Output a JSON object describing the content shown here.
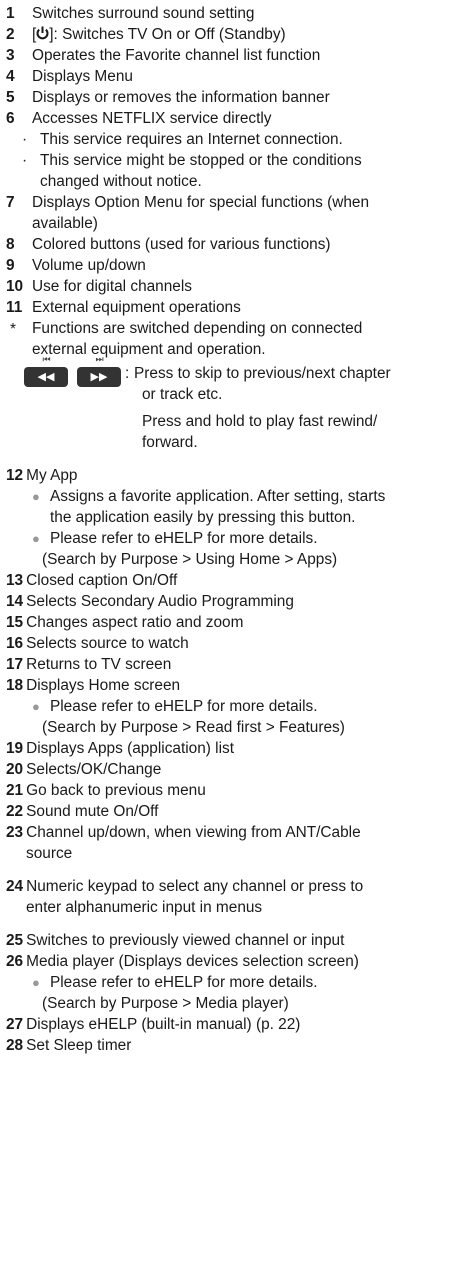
{
  "items": [
    {
      "n": "1",
      "text": "Switches surround sound setting"
    },
    {
      "n": "2",
      "bracket_open": "[",
      "icon": "power-icon",
      "text": "]: Switches TV On or Off (Standby)"
    },
    {
      "n": "3",
      "text": "Operates the Favorite channel list function"
    },
    {
      "n": "4",
      "text": "Displays Menu"
    },
    {
      "n": "5",
      "text": "Displays or removes the information banner"
    },
    {
      "n": "6",
      "text": "Accesses NETFLIX service directly",
      "notes": [
        "This service requires an Internet connection.",
        "This service might be stopped or the conditions",
        "changed without notice."
      ]
    },
    {
      "n": "7",
      "lines": [
        "Displays Option Menu for special functions (when",
        "available)"
      ]
    },
    {
      "n": "8",
      "text": "Colored buttons (used for various functions)"
    },
    {
      "n": "9",
      "text": "Volume up/down"
    },
    {
      "n": "10",
      "text": "Use for digital channels"
    },
    {
      "n": "11",
      "text": "External equipment operations",
      "asterisk": [
        "Functions are switched depending on connected",
        "external equipment and operation."
      ],
      "skip": {
        "prev_small": "⏮",
        "next_small": "⏭",
        "prev": "◀◀",
        "next": "▶▶",
        "colon": ":",
        "lines": [
          "Press to skip to previous/next chapter",
          "or track etc.",
          "Press and hold to play fast rewind/",
          "forward."
        ]
      }
    },
    {
      "n": "12",
      "text": "My App",
      "notes": [
        "Assigns a favorite application. After setting, starts",
        "the application easily by pressing this button.",
        "Please refer to eHELP for more details.",
        "(Search by Purpose > Using Home > Apps)"
      ]
    },
    {
      "n": "13",
      "text": "Closed caption On/Off"
    },
    {
      "n": "14",
      "text": "Selects Secondary Audio Programming"
    },
    {
      "n": "15",
      "text": "Changes aspect ratio and zoom"
    },
    {
      "n": "16",
      "text": "Selects source to watch"
    },
    {
      "n": "17",
      "text": "Returns to TV screen"
    },
    {
      "n": "18",
      "text": "Displays Home screen",
      "notes": [
        "Please refer to eHELP for more details.",
        "(Search by Purpose > Read first > Features)"
      ]
    },
    {
      "n": "19",
      "text": "Displays Apps (application) list"
    },
    {
      "n": "20",
      "text": "Selects/OK/Change"
    },
    {
      "n": "21",
      "text": "Go back to previous menu"
    },
    {
      "n": "22",
      "text": "Sound mute On/Off"
    },
    {
      "n": "23",
      "lines": [
        "Channel up/down, when viewing from ANT/Cable",
        "source"
      ]
    },
    {
      "n": "24",
      "lines": [
        "Numeric keypad to select any channel or press to",
        "enter alphanumeric input in menus"
      ]
    },
    {
      "n": "25",
      "text": "Switches to previously viewed channel or input"
    },
    {
      "n": "26",
      "text": "Media player (Displays devices selection screen)",
      "notes": [
        "Please refer to eHELP for more details.",
        "(Search by Purpose > Media player)"
      ]
    },
    {
      "n": "27",
      "text": "Displays eHELP (built-in manual) (p. 22)"
    },
    {
      "n": "28",
      "text": "Set Sleep timer"
    }
  ],
  "marks": {
    "interpunct": "·",
    "dot": "●",
    "asterisk": "*"
  },
  "colors": {
    "text": "#1a1a1a",
    "bullet_dot": "#999999",
    "button": "#333333"
  }
}
